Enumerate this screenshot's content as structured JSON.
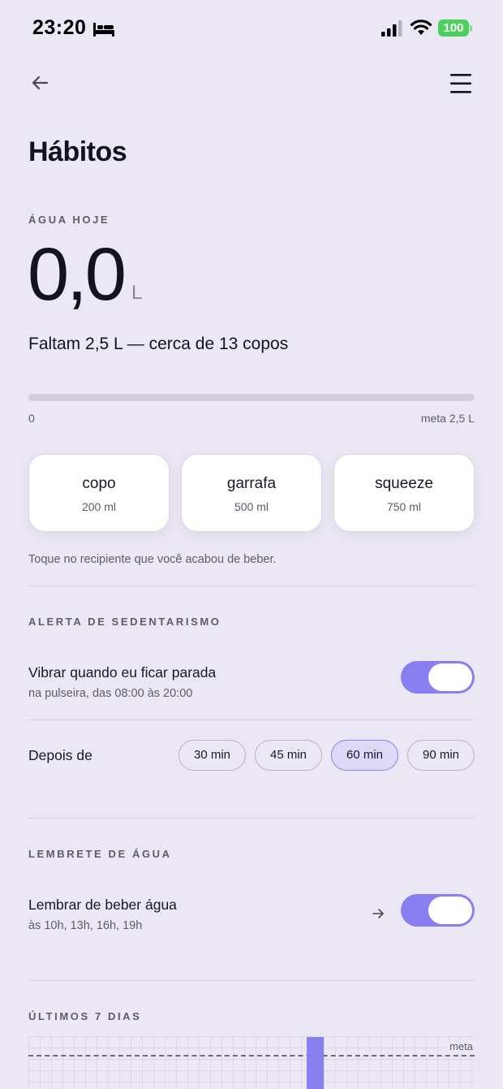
{
  "status": {
    "time": "23:20",
    "battery": "100"
  },
  "header": {
    "title": "Hábitos"
  },
  "water": {
    "label": "ÁGUA HOJE",
    "value": "0,0",
    "unit": "L",
    "remaining": "Faltam 2,5 L — cerca de 13 copos",
    "progress_fraction": 0,
    "progress_min": "0",
    "progress_max": "meta 2,5 L",
    "containers": [
      {
        "name": "copo",
        "volume": "200 ml"
      },
      {
        "name": "garrafa",
        "volume": "500 ml"
      },
      {
        "name": "squeeze",
        "volume": "750 ml"
      }
    ],
    "hint": "Toque no recipiente que você acabou de beber."
  },
  "sedentary": {
    "label": "ALERTA DE SEDENTARISMO",
    "title": "Vibrar quando eu ficar parada",
    "subtitle": "na pulseira, das 08:00 às 20:00",
    "enabled": true,
    "after_label": "Depois de",
    "options": [
      "30 min",
      "45 min",
      "60 min",
      "90 min"
    ],
    "selected": "60 min"
  },
  "reminder": {
    "label": "LEMBRETE DE ÁGUA",
    "title": "Lembrar de beber água",
    "subtitle": "às 10h, 13h, 16h, 19h",
    "enabled": true
  },
  "history": {
    "label": "ÚLTIMOS 7 DIAS",
    "goal_label": "meta"
  },
  "colors": {
    "accent": "#8a7ff0",
    "background": "#ebe7f4",
    "battery": "#4bd05e"
  },
  "icons": {
    "back": "arrow-left-icon",
    "menu": "hamburger-menu-icon",
    "reminder_action": "arrow-right-icon",
    "status_sleep": "bed-icon"
  }
}
